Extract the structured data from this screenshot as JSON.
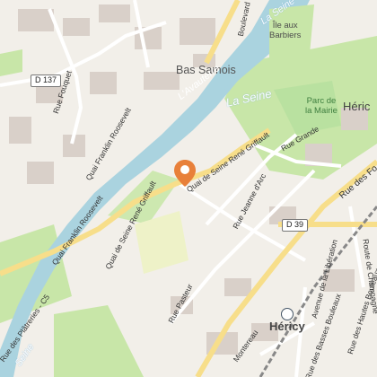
{
  "map": {
    "places": {
      "bas_samois": "Bas Samois",
      "hericy": "Héricy",
      "hericy_cut": "Héric",
      "ile_aux_barbiers": "Île aux\nBarbiers",
      "parc_de_la_mairie": "Parc de\nla Mairie"
    },
    "water": {
      "la_seine_main": "La Seine",
      "la_seine_top": "La Seine",
      "la_seine_bottom": "Seine",
      "l_avauterre": "L'Avauterre"
    },
    "roads": {
      "d137": "D 137",
      "d39": "D 39",
      "rue_fouquet": "Rue Fouquet",
      "quai_franklin_top": "Quai Franklin Roosevelt",
      "quai_franklin_bottom": "Quai Franklin Roosevelt",
      "quai_seine_rene_top": "Quai de Seine René Griffault",
      "quai_seine_rene_bottom": "Quai de Seine René Griffault",
      "rue_grande": "Rue Grande",
      "rue_des_fo": "Rue des Fo",
      "rue_jeanne_dar": "Rue Jeanne d'Arc",
      "rue_pasteur": "Rue Pasteur",
      "avenue_liberation": "Avenue de la Libération",
      "route_champagne": "Route de Champagne",
      "rue_hautes_bouleaux": "Rue des Hautes Bouleaux",
      "rue_basses_bouleaux": "Rue des Basses Bouleaux",
      "rue_platreries": "Rue des Plâtreries - C5",
      "boulevard": "Boulevard",
      "montereau": "Montereau"
    },
    "marker": {
      "icon": "location-pin-icon",
      "color": "#e8803a"
    },
    "colors": {
      "water": "#aad3df",
      "park": "#c8e6a8",
      "road_major": "#f7de8a",
      "building": "#d9d0c9"
    }
  }
}
